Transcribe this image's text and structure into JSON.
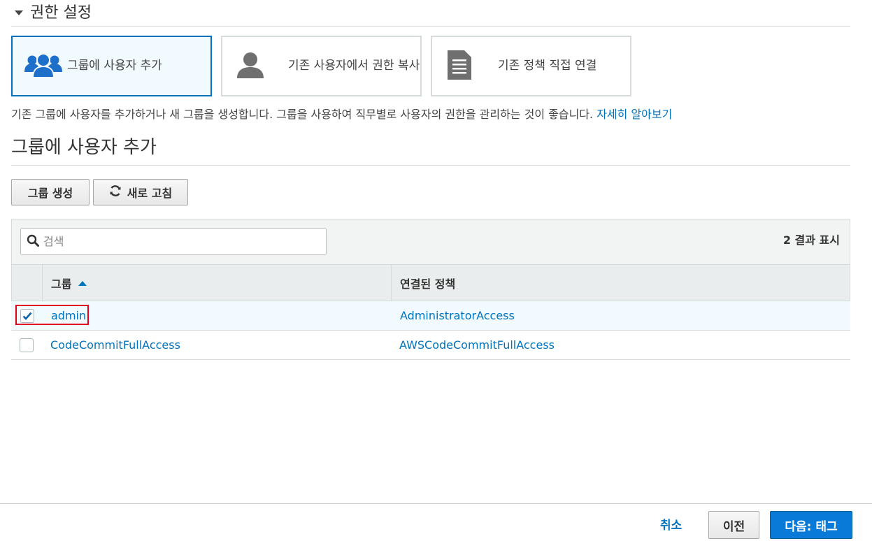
{
  "section": {
    "title": "권한 설정"
  },
  "options": [
    {
      "label": "그룹에 사용자 추가",
      "icon": "users-group-icon",
      "selected": true
    },
    {
      "label": "기존 사용자에서 권한 복사",
      "icon": "user-icon",
      "selected": false
    },
    {
      "label": "기존 정책 직접 연결",
      "icon": "document-icon",
      "selected": false
    }
  ],
  "description": {
    "text": "기존 그룹에 사용자를 추가하거나 새 그룹을 생성합니다. 그룹을 사용하여 직무별로 사용자의 권한을 관리하는 것이 좋습니다. ",
    "link": "자세히 알아보기"
  },
  "subsection": {
    "title": "그룹에 사용자 추가"
  },
  "toolbar": {
    "create_label": "그룹 생성",
    "refresh_label": "새로 고침"
  },
  "search": {
    "placeholder": "검색"
  },
  "results": {
    "label": "2 결과 표시"
  },
  "table": {
    "columns": [
      "그룹",
      "연결된 정책"
    ],
    "rows": [
      {
        "group": "admin",
        "policy": "AdministratorAccess",
        "checked": true
      },
      {
        "group": "CodeCommitFullAccess",
        "policy": "AWSCodeCommitFullAccess",
        "checked": false
      }
    ]
  },
  "footer": {
    "cancel_label": "취소",
    "prev_label": "이전",
    "next_label": "다음: 태그"
  },
  "colors": {
    "accent": "#0073bb",
    "primary_button": "#0a7ad8",
    "highlight": "#e0001b"
  }
}
